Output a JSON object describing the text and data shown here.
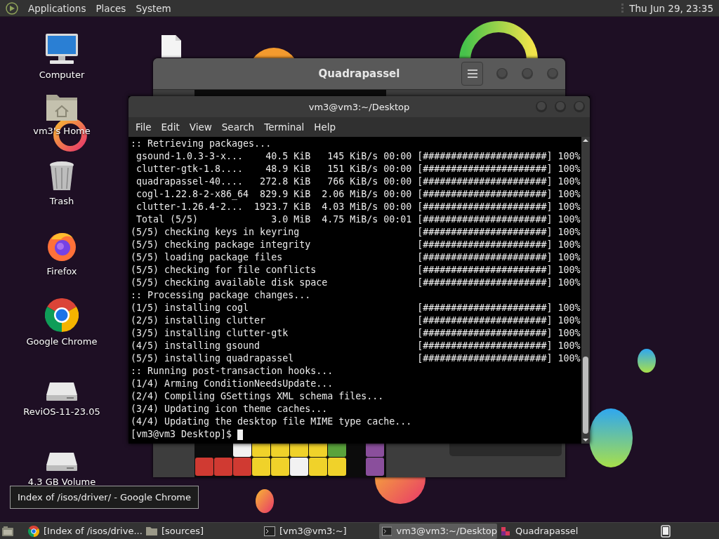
{
  "top_panel": {
    "menus": [
      "Applications",
      "Places",
      "System"
    ],
    "clock": "Thu Jun 29, 23:35"
  },
  "desktop_icons": [
    {
      "label": "Computer",
      "kind": "computer"
    },
    {
      "label": "vm3's Home",
      "kind": "home"
    },
    {
      "label": "Trash",
      "kind": "trash"
    },
    {
      "label": "Firefox",
      "kind": "firefox"
    },
    {
      "label": "Google Chrome",
      "kind": "chrome"
    },
    {
      "label": "ReviOS-11-23.05",
      "kind": "drive"
    },
    {
      "label": "4.3 GB Volume",
      "kind": "drive"
    }
  ],
  "game_window": {
    "title": "Quadrapassel",
    "board_rows": [
      {
        "cells": [
          null,
          null,
          {
            "color": "#f2f2f2"
          },
          {
            "color": "#f0d22a"
          },
          {
            "color": "#f0d22a"
          },
          {
            "color": "#f0d22a"
          },
          {
            "color": "#f0d22a"
          },
          {
            "color": "#5aa33c"
          },
          null,
          {
            "color": "#8a4f9c"
          }
        ]
      },
      {
        "cells": [
          {
            "color": "#d03a32"
          },
          {
            "color": "#d03a32"
          },
          {
            "color": "#d03a32"
          },
          {
            "color": "#f0d22a"
          },
          {
            "color": "#f0d22a"
          },
          {
            "color": "#f2f2f2"
          },
          {
            "color": "#f0d22a"
          },
          {
            "color": "#f0d22a"
          },
          null,
          {
            "color": "#8a4f9c"
          }
        ]
      }
    ]
  },
  "terminal": {
    "title": "vm3@vm3:~/Desktop",
    "menus": [
      "File",
      "Edit",
      "View",
      "Search",
      "Terminal",
      "Help"
    ],
    "lines": [
      {
        "text": ":: Retrieving packages..."
      },
      {
        "text": " gsound-1.0.3-3-x...    40.5 KiB   145 KiB/s 00:00",
        "progress": "[######################] 100%"
      },
      {
        "text": " clutter-gtk-1.8....    48.9 KiB   151 KiB/s 00:00",
        "progress": "[######################] 100%"
      },
      {
        "text": " quadrapassel-40....   272.8 KiB   766 KiB/s 00:00",
        "progress": "[######################] 100%"
      },
      {
        "text": " cogl-1.22.8-2-x86_64  829.9 KiB  2.06 MiB/s 00:00",
        "progress": "[######################] 100%"
      },
      {
        "text": " clutter-1.26.4-2...  1923.7 KiB  4.03 MiB/s 00:00",
        "progress": "[######################] 100%"
      },
      {
        "text": " Total (5/5)             3.0 MiB  4.75 MiB/s 00:01",
        "progress": "[######################] 100%"
      },
      {
        "text": "(5/5) checking keys in keyring",
        "progress": "[######################] 100%"
      },
      {
        "text": "(5/5) checking package integrity",
        "progress": "[######################] 100%"
      },
      {
        "text": "(5/5) loading package files",
        "progress": "[######################] 100%"
      },
      {
        "text": "(5/5) checking for file conflicts",
        "progress": "[######################] 100%"
      },
      {
        "text": "(5/5) checking available disk space",
        "progress": "[######################] 100%"
      },
      {
        "text": ":: Processing package changes..."
      },
      {
        "text": "(1/5) installing cogl",
        "progress": "[######################] 100%"
      },
      {
        "text": "(2/5) installing clutter",
        "progress": "[######################] 100%"
      },
      {
        "text": "(3/5) installing clutter-gtk",
        "progress": "[######################] 100%"
      },
      {
        "text": "(4/5) installing gsound",
        "progress": "[######################] 100%"
      },
      {
        "text": "(5/5) installing quadrapassel",
        "progress": "[######################] 100%"
      },
      {
        "text": ":: Running post-transaction hooks..."
      },
      {
        "text": "(1/4) Arming ConditionNeedsUpdate..."
      },
      {
        "text": "(2/4) Compiling GSettings XML schema files..."
      },
      {
        "text": "(3/4) Updating icon theme caches..."
      },
      {
        "text": "(4/4) Updating the desktop file MIME type cache..."
      }
    ],
    "prompt": "[vm3@vm3 Desktop]$"
  },
  "tooltip": "Index of /isos/driver/ - Google Chrome",
  "taskbar": [
    {
      "label": "[Index of /isos/drive...",
      "kind": "browser",
      "selected": false
    },
    {
      "label": "[sources]",
      "kind": "folder",
      "selected": false
    },
    {
      "label": "[vm3@vm3:~]",
      "kind": "terminal",
      "selected": false
    },
    {
      "label": "vm3@vm3:~/Desktop",
      "kind": "terminal",
      "selected": true
    },
    {
      "label": "Quadrapassel",
      "kind": "game",
      "selected": false
    }
  ]
}
